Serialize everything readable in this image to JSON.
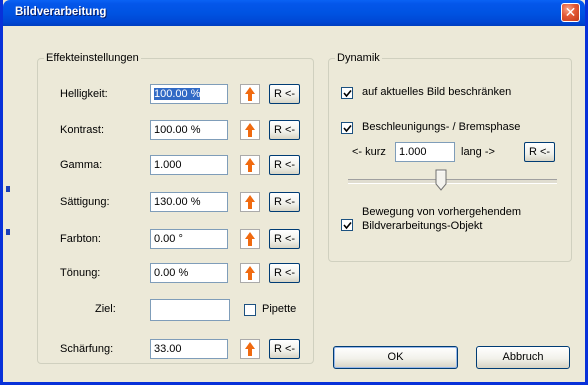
{
  "window": {
    "title": "Bildverarbeitung"
  },
  "effects": {
    "legend": "Effekteinstellungen",
    "rows": [
      {
        "label": "Helligkeit:",
        "value": "100.00 %",
        "reset": "R <-"
      },
      {
        "label": "Kontrast:",
        "value": "100.00 %",
        "reset": "R <-"
      },
      {
        "label": "Gamma:",
        "value": "1.000",
        "reset": "R <-"
      },
      {
        "label": "Sättigung:",
        "value": "130.00 %",
        "reset": "R <-"
      },
      {
        "label": "Farbton:",
        "value": "0.00 °",
        "reset": "R <-"
      },
      {
        "label": "Tönung:",
        "value": "0.00 %",
        "reset": "R <-"
      }
    ],
    "target_label": "Ziel:",
    "pipette_label": "Pipette",
    "pipette_checked": false,
    "sharpen": {
      "label": "Schärfung:",
      "value": "33.00",
      "reset": "R <-"
    }
  },
  "dynamics": {
    "legend": "Dynamik",
    "limit_label": "auf aktuelles Bild beschränken",
    "limit_checked": true,
    "accel_label": "Beschleunigungs- / Bremsphase",
    "accel_checked": true,
    "short_label": "<- kurz",
    "phase_value": "1.000",
    "long_label": "lang ->",
    "reset": "R <-",
    "slider_position": 0.44,
    "motion_label_line1": "Bewegung von vorhergehendem",
    "motion_label_line2": "Bildverarbeitungs-Objekt",
    "motion_checked": true
  },
  "buttons": {
    "ok": "OK",
    "cancel": "Abbruch"
  },
  "colors": {
    "arrow": "#f06a10",
    "title_bar": "#0053e2",
    "selection": "#316ac5"
  }
}
